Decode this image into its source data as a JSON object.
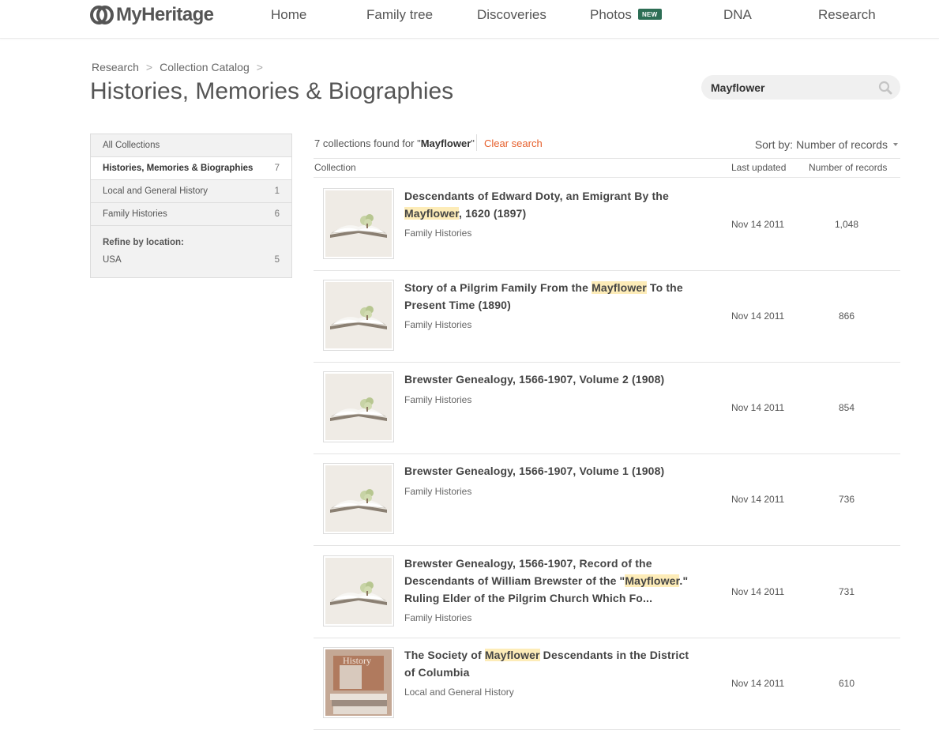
{
  "brand": {
    "name": "MyHeritage"
  },
  "nav": {
    "home": "Home",
    "family_tree": "Family tree",
    "discoveries": "Discoveries",
    "photos": "Photos",
    "photos_badge": "NEW",
    "dna": "DNA",
    "research": "Research"
  },
  "breadcrumb": {
    "items": [
      "Research",
      "Collection Catalog"
    ],
    "separator": ">"
  },
  "page_title": "Histories, Memories & Biographies",
  "search": {
    "value": "Mayflower"
  },
  "sidebar": {
    "categories": [
      {
        "label": "All Collections",
        "count": ""
      },
      {
        "label": "Histories, Memories & Biographies",
        "count": "7"
      },
      {
        "label": "Local and General History",
        "count": "1"
      },
      {
        "label": "Family Histories",
        "count": "6"
      }
    ],
    "refine_heading": "Refine by location:",
    "locations": [
      {
        "label": "USA",
        "count": "5"
      }
    ]
  },
  "results": {
    "summary_prefix": "7 collections found for \"",
    "summary_term": "Mayflower",
    "summary_suffix": "\"",
    "clear_label": "Clear search",
    "sort_label": "Sort by:",
    "sort_value": "Number of records",
    "columns": {
      "collection": "Collection",
      "updated": "Last updated",
      "records": "Number of records"
    },
    "items": [
      {
        "title_parts": [
          "Descendants of Edward Doty, an Emigrant By the ",
          "Mayflower",
          ", 1620 (1897)"
        ],
        "category": "Family Histories",
        "updated": "Nov 14 2011",
        "records": "1,048",
        "thumb": "book-tree"
      },
      {
        "title_parts": [
          "Story of a Pilgrim Family From the ",
          "Mayflower",
          " To the Present Time (1890)"
        ],
        "category": "Family Histories",
        "updated": "Nov 14 2011",
        "records": "866",
        "thumb": "book-tree"
      },
      {
        "title_parts": [
          "Brewster Genealogy, 1566-1907, Volume 2 (1908)",
          "",
          ""
        ],
        "category": "Family Histories",
        "updated": "Nov 14 2011",
        "records": "854",
        "thumb": "book-tree"
      },
      {
        "title_parts": [
          "Brewster Genealogy, 1566-1907, Volume 1 (1908)",
          "",
          ""
        ],
        "category": "Family Histories",
        "updated": "Nov 14 2011",
        "records": "736",
        "thumb": "book-tree"
      },
      {
        "title_parts": [
          "Brewster Genealogy, 1566-1907, Record of the Descendants of William Brewster of the \"",
          "Mayflower",
          ".\" Ruling Elder of the Pilgrim Church Which Fo..."
        ],
        "category": "Family Histories",
        "updated": "Nov 14 2011",
        "records": "731",
        "thumb": "book-tree"
      },
      {
        "title_parts": [
          "The Society of ",
          "Mayflower",
          " Descendants in the District of Columbia"
        ],
        "category": "Local and General History",
        "updated": "Nov 14 2011",
        "records": "610",
        "thumb": "history-books",
        "thumb_text": "History"
      }
    ]
  },
  "colors": {
    "accent_link": "#e65f2b",
    "highlight": "#fdecb8",
    "badge": "#2d6e55"
  }
}
